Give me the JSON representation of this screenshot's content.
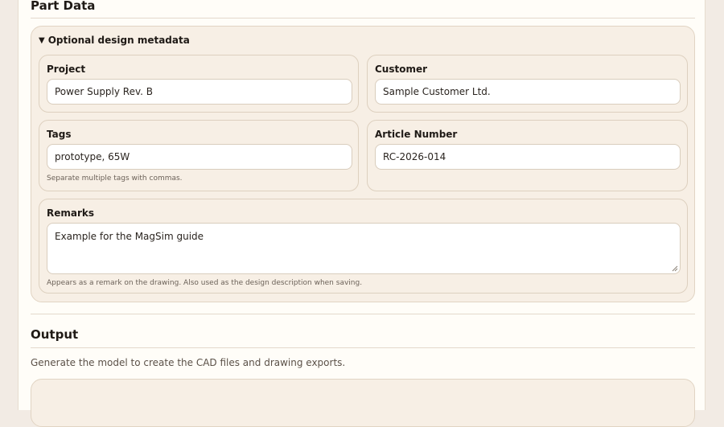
{
  "part_data": {
    "title": "Part Data",
    "metadata": {
      "summary_label": "Optional design metadata",
      "toggle_icon": "triangle-down-icon",
      "project": {
        "label": "Project",
        "value": "Power Supply Rev. B"
      },
      "customer": {
        "label": "Customer",
        "value": "Sample Customer Ltd."
      },
      "tags": {
        "label": "Tags",
        "value": "prototype, 65W",
        "hint": "Separate multiple tags with commas."
      },
      "article_number": {
        "label": "Article Number",
        "value": "RC-2026-014"
      },
      "remarks": {
        "label": "Remarks",
        "value": "Example for the MagSim guide",
        "hint": "Appears as a remark on the drawing. Also used as the design description when saving."
      }
    }
  },
  "output": {
    "title": "Output",
    "description": "Generate the model to create the CAD files and drawing exports."
  },
  "colors": {
    "page_bg": "#fffdf8",
    "panel_bg": "#f7efe5",
    "border": "#ddd0bf"
  }
}
